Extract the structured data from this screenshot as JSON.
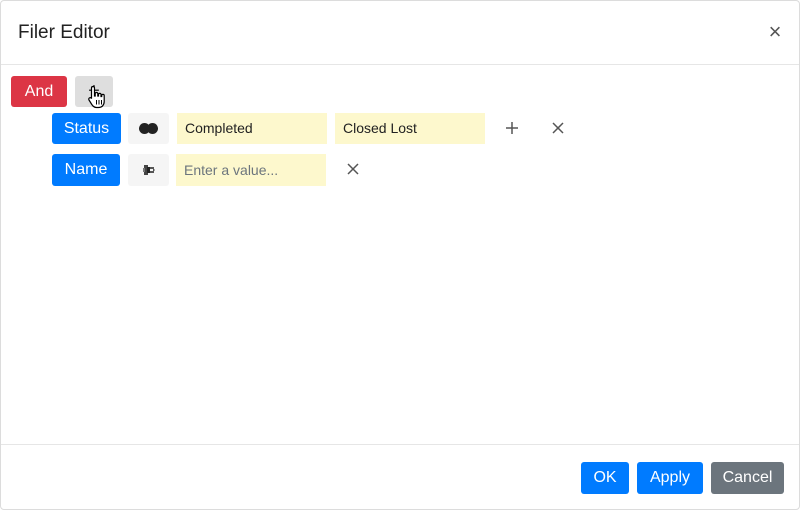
{
  "dialog": {
    "title": "Filer Editor",
    "close_glyph": "×"
  },
  "group": {
    "operator_label": "And",
    "add_glyph": "+"
  },
  "conditions": [
    {
      "field": "Status",
      "operator_icon": "in-list-icon",
      "values": [
        "Completed",
        "Closed Lost"
      ]
    },
    {
      "field": "Name",
      "operator_icon": "contains-abc-icon",
      "placeholder": "Enter a value..."
    }
  ],
  "footer": {
    "ok_label": "OK",
    "apply_label": "Apply",
    "cancel_label": "Cancel"
  },
  "colors": {
    "and_button": "#dc3545",
    "field_button": "#007bff",
    "value_background": "#fdf8cd",
    "cancel_button": "#6c757d"
  }
}
